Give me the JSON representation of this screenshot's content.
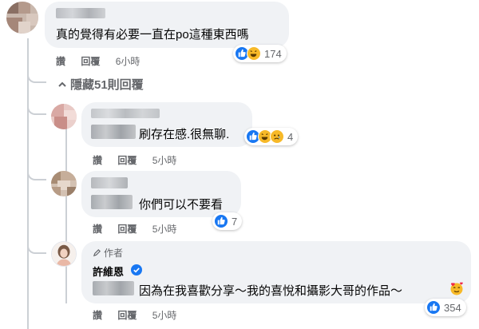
{
  "comments": [
    {
      "text": "真的覺得有必要一直在po這種東西嗎",
      "actions": {
        "like": "讚",
        "reply": "回覆",
        "time": "6小時"
      },
      "reactions": {
        "count": "174",
        "icons": [
          "like-icon",
          "haha-icon"
        ]
      }
    },
    {
      "text": "刷存在感.很無聊.",
      "actions": {
        "like": "讚",
        "reply": "回覆",
        "time": "5小時"
      },
      "reactions": {
        "count": "4",
        "icons": [
          "like-icon",
          "haha-icon",
          "sad-icon"
        ]
      }
    },
    {
      "text": "你們可以不要看",
      "actions": {
        "like": "讚",
        "reply": "回覆",
        "time": "5小時"
      },
      "reactions": {
        "count": "7",
        "icons": [
          "like-icon"
        ]
      }
    },
    {
      "author_badge": "作者",
      "author_name": "許維恩",
      "text": "因為在我喜歡分享～我的喜悅和攝影大哥的作品～",
      "actions": {
        "like": "讚",
        "reply": "回覆",
        "time": "5小時"
      },
      "reactions": {
        "count": "354",
        "icons": [
          "like-icon"
        ]
      }
    }
  ],
  "replies_toggle": "隱藏51則回覆",
  "colors": {
    "like": "#1877f2",
    "haha": "#f7b928",
    "muted": "#65676b",
    "bubble": "#f0f2f5"
  }
}
